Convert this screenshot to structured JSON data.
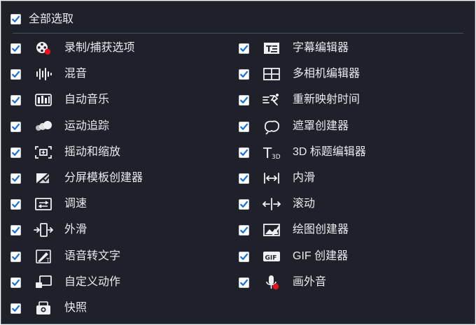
{
  "select_all": {
    "label": "全部选取",
    "checked": true
  },
  "left_column": [
    {
      "label": "录制/捕获选项",
      "icon": "film-record-icon",
      "checked": true
    },
    {
      "label": "混音",
      "icon": "sound-mixer-icon",
      "checked": true
    },
    {
      "label": "自动音乐",
      "icon": "auto-music-icon",
      "checked": true
    },
    {
      "label": "运动追踪",
      "icon": "motion-tracking-icon",
      "checked": true
    },
    {
      "label": "摇动和缩放",
      "icon": "pan-zoom-icon",
      "checked": true
    },
    {
      "label": "分屏模板创建器",
      "icon": "split-screen-icon",
      "checked": true
    },
    {
      "label": "调速",
      "icon": "speed-icon",
      "checked": true
    },
    {
      "label": "外滑",
      "icon": "slide-out-icon",
      "checked": true
    },
    {
      "label": "语音转文字",
      "icon": "speech-to-text-icon",
      "checked": true
    },
    {
      "label": "自定义动作",
      "icon": "custom-motion-icon",
      "checked": true
    },
    {
      "label": "快照",
      "icon": "snapshot-icon",
      "checked": true
    }
  ],
  "right_column": [
    {
      "label": "字幕编辑器",
      "icon": "subtitle-editor-icon",
      "checked": true
    },
    {
      "label": "多相机编辑器",
      "icon": "multicam-editor-icon",
      "checked": true
    },
    {
      "label": "重新映射时间",
      "icon": "time-remap-icon",
      "checked": true
    },
    {
      "label": "遮罩创建器",
      "icon": "mask-creator-icon",
      "checked": true
    },
    {
      "label": "3D 标题编辑器",
      "icon": "title-3d-icon",
      "checked": true
    },
    {
      "label": "内滑",
      "icon": "slide-in-icon",
      "checked": true
    },
    {
      "label": "滚动",
      "icon": "scroll-icon",
      "checked": true
    },
    {
      "label": "绘图创建器",
      "icon": "painting-creator-icon",
      "checked": true
    },
    {
      "label": "GIF 创建器",
      "icon": "gif-creator-icon",
      "checked": true
    },
    {
      "label": "画外音",
      "icon": "voiceover-mic-icon",
      "checked": true
    }
  ],
  "colors": {
    "background": "#1e212a",
    "text": "#e9ebee",
    "check": "#1a6fd6",
    "record_dot": "#e8121f"
  }
}
